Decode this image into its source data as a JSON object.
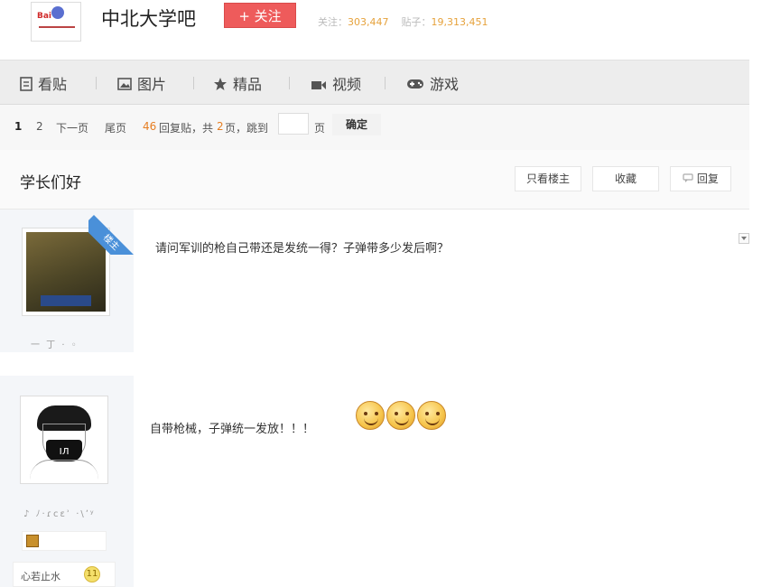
{
  "header": {
    "logo_icon": "baidu-tieba-school-logo",
    "forum_name": "中北大学吧",
    "follow_label": "+ 关注",
    "follow_color": "#ee5b5b",
    "follow_count_label": "关注：",
    "follow_count": "303,447",
    "post_count_label": "贴子：",
    "post_count": "19,313,451"
  },
  "tabs": [
    {
      "label": "看贴",
      "icon": "document-icon"
    },
    {
      "label": "图片",
      "icon": "image-icon"
    },
    {
      "label": "精品",
      "icon": "star-icon"
    },
    {
      "label": "视频",
      "icon": "video-camera-icon"
    },
    {
      "label": "游戏",
      "icon": "gamepad-icon"
    }
  ],
  "pager": {
    "current_page": "1",
    "page2": "2",
    "next": "下一页",
    "last": "尾页",
    "reply_count": "46",
    "reply_label": "回复贴，共",
    "total_pages": "2",
    "total_suffix": "页，跳到",
    "page_unit": "页",
    "confirm": "确定"
  },
  "thread": {
    "title": "学长们好",
    "only_author": "只看楼主",
    "favorite": "收藏",
    "reply": "回复"
  },
  "posts": [
    {
      "author_badge": "楼主",
      "username": "一 丁 · ◦",
      "content": "请问军训的枪自己带还是发统一得？子弹带多少发后啊？"
    },
    {
      "username": "♪ ﾉ·ɾcεʾ ·\\ʼʸ",
      "content": "自带枪械，子弹统一发放！！！",
      "level_name": "心若止水",
      "level": "11",
      "emoticon": "smiley-face-icon"
    }
  ],
  "colors": {
    "accent_orange": "#e67e22",
    "badge_blue": "#4a90d9"
  }
}
